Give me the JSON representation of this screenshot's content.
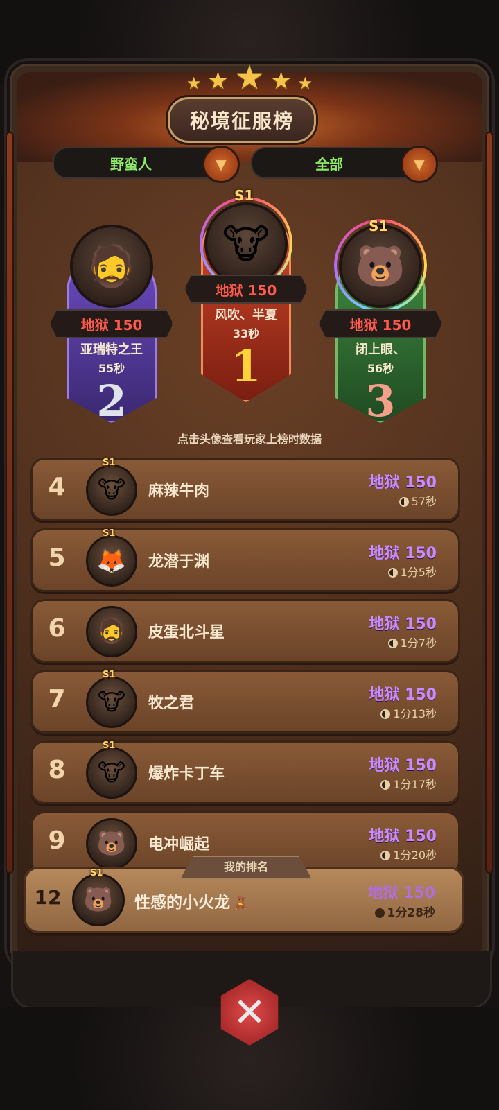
{
  "header": {
    "title": "秘境征服榜",
    "stars": [
      "★",
      "★",
      "★",
      "★",
      "★"
    ]
  },
  "filters": {
    "class_label": "野蛮人",
    "scope_label": "全部",
    "dropdown_glyph": "▼"
  },
  "podium": {
    "first": {
      "rank": "1",
      "season": "S1",
      "level": "地狱 150",
      "name": "风吹、半夏",
      "time": "33秒",
      "avatar": "🐮"
    },
    "second": {
      "rank": "2",
      "level": "地狱 150",
      "name": "亚瑞特之王",
      "time": "55秒",
      "avatar": "🧔"
    },
    "third": {
      "rank": "3",
      "season": "S1",
      "level": "地狱 150",
      "name": "闭上眼、",
      "time": "56秒",
      "avatar": "🐻"
    }
  },
  "hint": "点击头像查看玩家上榜时数据",
  "rows": [
    {
      "rank": "4",
      "season": "S1",
      "name": "麻辣牛肉",
      "level": "地狱 150",
      "time": "57秒",
      "avatar": "🐮"
    },
    {
      "rank": "5",
      "season": "S1",
      "name": "龙潜于渊",
      "level": "地狱 150",
      "time": "1分5秒",
      "avatar": "🦊"
    },
    {
      "rank": "6",
      "season": "",
      "name": "皮蛋北斗星",
      "level": "地狱 150",
      "time": "1分7秒",
      "avatar": "🧔"
    },
    {
      "rank": "7",
      "season": "S1",
      "name": "牧之君",
      "level": "地狱 150",
      "time": "1分13秒",
      "avatar": "🐮"
    },
    {
      "rank": "8",
      "season": "S1",
      "name": "爆炸卡丁车",
      "level": "地狱 150",
      "time": "1分17秒",
      "avatar": "🐮"
    },
    {
      "rank": "9",
      "season": "",
      "name": "电冲崛起",
      "level": "地狱 150",
      "time": "1分20秒",
      "avatar": "🐻"
    }
  ],
  "my_rank": {
    "tab_label": "我的排名",
    "rank": "12",
    "season": "S1",
    "name": "性感的小火龙",
    "badge": "🧸",
    "level": "地狱 150",
    "time": "1分28秒",
    "avatar": "🐻"
  },
  "bottom": {
    "close_glyph": "✕"
  }
}
